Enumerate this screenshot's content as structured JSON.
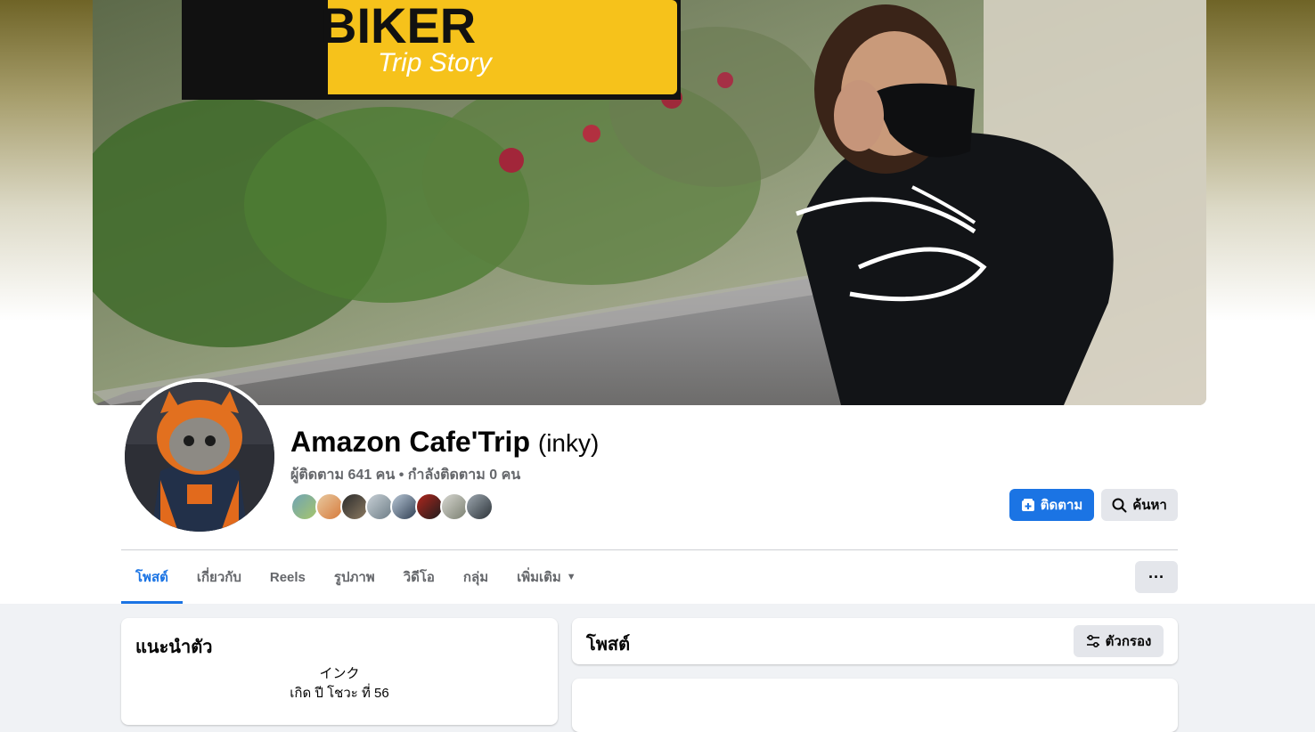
{
  "cover": {
    "logo_title": "BIKER",
    "logo_subtitle": "Trip Story"
  },
  "profile": {
    "name": "Amazon Cafe'Trip",
    "alternate_name": "(inky)",
    "follow_stats": "ผู้ติดตาม 641 คน • กำลังติดตาม 0 คน"
  },
  "actions": {
    "follow_label": "ติดตาม",
    "search_label": "ค้นหา"
  },
  "tabs": [
    {
      "label": "โพสต์",
      "active": true
    },
    {
      "label": "เกี่ยวกับ",
      "active": false
    },
    {
      "label": "Reels",
      "active": false
    },
    {
      "label": "รูปภาพ",
      "active": false
    },
    {
      "label": "วิดีโอ",
      "active": false
    },
    {
      "label": "กลุ่ม",
      "active": false
    },
    {
      "label": "เพิ่มเติม",
      "active": false
    }
  ],
  "more_menu_label": "···",
  "intro": {
    "title": "แนะนำตัว",
    "line1": "インク",
    "line2": "เกิด ปี โชวะ ที่ 56"
  },
  "posts": {
    "title": "โพสต์",
    "filter_label": "ตัวกรอง"
  },
  "colors": {
    "accent": "#1b74e4",
    "secondary_button": "#e4e6eb",
    "background": "#f0f2f5",
    "muted_text": "#65676b"
  },
  "icons": {
    "follow": "follow-icon",
    "search": "search-icon",
    "filter": "filter-icon",
    "dropdown": "caret-down-icon",
    "more": "more-dots-icon"
  }
}
